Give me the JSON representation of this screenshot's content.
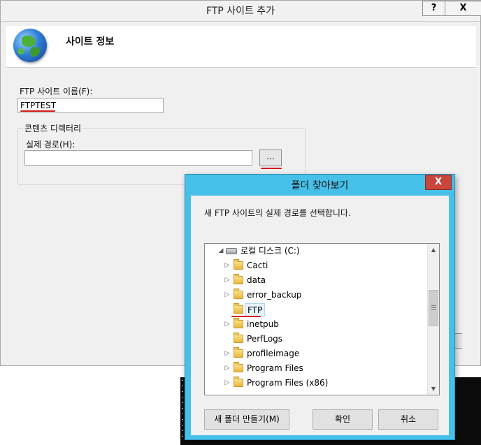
{
  "main_dialog": {
    "title": "FTP 사이트 추가",
    "help_label": "?",
    "close_label": "X",
    "header_title": "사이트 정보",
    "site_name_label": "FTP 사이트 이름(F):",
    "site_name_value": "FTPTEST",
    "content_dir_label": "콘텐츠 디렉터리",
    "physical_path_label": "실제 경로(H):",
    "physical_path_value": "",
    "browse_button_label": "..."
  },
  "browse_dialog": {
    "title": "폴더 찾아보기",
    "close_label": "X",
    "description": "새 FTP 사이트의 실제 경로를 선택합니다.",
    "tree": {
      "root": {
        "label": "로컬 디스크 (C:)",
        "icon": "drive-icon",
        "expanded": true
      },
      "folders": [
        {
          "label": "Cacti",
          "has_children": true
        },
        {
          "label": "data",
          "has_children": true
        },
        {
          "label": "error_backup",
          "has_children": true
        },
        {
          "label": "FTP",
          "has_children": false,
          "selected": true
        },
        {
          "label": "inetpub",
          "has_children": true
        },
        {
          "label": "PerfLogs",
          "has_children": false
        },
        {
          "label": "profileimage",
          "has_children": true
        },
        {
          "label": "Program Files",
          "has_children": true
        },
        {
          "label": "Program Files (x86)",
          "has_children": true
        }
      ]
    },
    "buttons": {
      "new_folder": "새 폴더 만들기(M)",
      "ok": "확인",
      "cancel": "취소"
    }
  },
  "colors": {
    "browse_frame": "#46c0e8",
    "close_button": "#c9463d",
    "annotation_red": "#d31515"
  }
}
